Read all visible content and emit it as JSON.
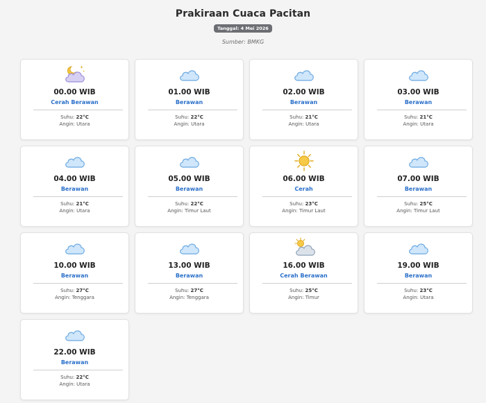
{
  "title": "Prakiraan Cuaca Pacitan",
  "date_badge": "Tanggal: 4 Mei 2026",
  "source": "Sumber: BMKG",
  "labels": {
    "temp": "Suhu:",
    "wind": "Angin:"
  },
  "colors": {
    "condition": "#2a6fc9",
    "badge_bg": "#6b6e73",
    "cloud_fill": "#cfe6fb",
    "cloud_stroke": "#6aa8e0",
    "sun": "#f4c542"
  },
  "forecast": [
    {
      "time": "00.00 WIB",
      "condition": "Cerah Berawan",
      "temp": "22°C",
      "wind": "Utara",
      "icon": "moon-cloud-icon"
    },
    {
      "time": "01.00 WIB",
      "condition": "Berawan",
      "temp": "22°C",
      "wind": "Utara",
      "icon": "cloud-icon"
    },
    {
      "time": "02.00 WIB",
      "condition": "Berawan",
      "temp": "21°C",
      "wind": "Utara",
      "icon": "cloud-icon"
    },
    {
      "time": "03.00 WIB",
      "condition": "Berawan",
      "temp": "21°C",
      "wind": "Utara",
      "icon": "cloud-icon"
    },
    {
      "time": "04.00 WIB",
      "condition": "Berawan",
      "temp": "21°C",
      "wind": "Utara",
      "icon": "cloud-icon"
    },
    {
      "time": "05.00 WIB",
      "condition": "Berawan",
      "temp": "22°C",
      "wind": "Timur Laut",
      "icon": "cloud-icon"
    },
    {
      "time": "06.00 WIB",
      "condition": "Cerah",
      "temp": "23°C",
      "wind": "Timur Laut",
      "icon": "sun-icon"
    },
    {
      "time": "07.00 WIB",
      "condition": "Berawan",
      "temp": "25°C",
      "wind": "Timur Laut",
      "icon": "cloud-icon"
    },
    {
      "time": "10.00 WIB",
      "condition": "Berawan",
      "temp": "27°C",
      "wind": "Tenggara",
      "icon": "cloud-icon"
    },
    {
      "time": "13.00 WIB",
      "condition": "Berawan",
      "temp": "27°C",
      "wind": "Tenggara",
      "icon": "cloud-icon"
    },
    {
      "time": "16.00 WIB",
      "condition": "Cerah Berawan",
      "temp": "25°C",
      "wind": "Timur",
      "icon": "sun-cloud-icon"
    },
    {
      "time": "19.00 WIB",
      "condition": "Berawan",
      "temp": "23°C",
      "wind": "Utara",
      "icon": "cloud-icon"
    },
    {
      "time": "22.00 WIB",
      "condition": "Berawan",
      "temp": "22°C",
      "wind": "Utara",
      "icon": "cloud-icon"
    }
  ]
}
